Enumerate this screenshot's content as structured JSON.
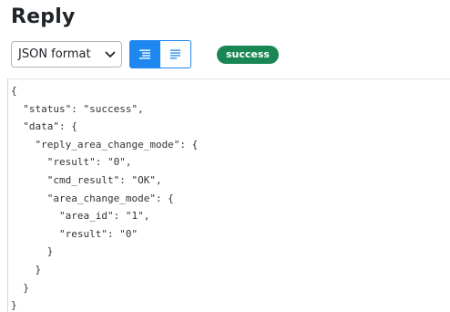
{
  "heading": "Reply",
  "toolbar": {
    "format_select": {
      "selected": "JSON format"
    },
    "view_buttons": {
      "active_color": "#1e87f0"
    },
    "status_badge": {
      "text": "success",
      "color": "#198754"
    }
  },
  "code_lines": [
    "{",
    "  \"status\": \"success\",",
    "  \"data\": {",
    "    \"reply_area_change_mode\": {",
    "      \"result\": \"0\",",
    "      \"cmd_result\": \"OK\",",
    "      \"area_change_mode\": {",
    "        \"area_id\": \"1\",",
    "        \"result\": \"0\"",
    "      }",
    "    }",
    "  }",
    "}"
  ]
}
